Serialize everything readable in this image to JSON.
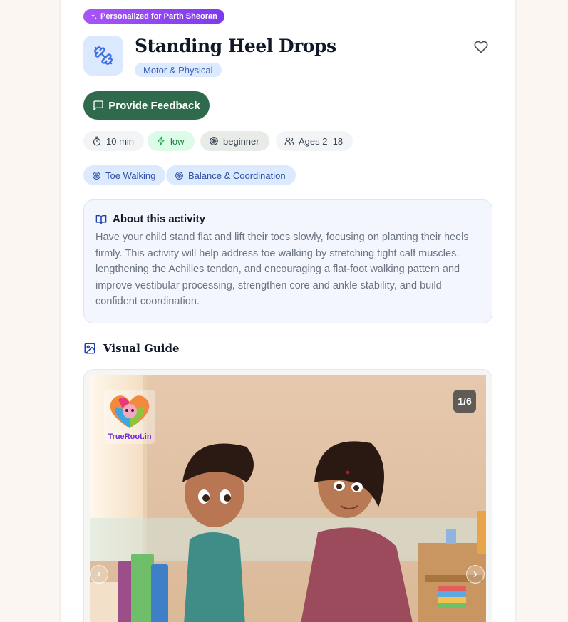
{
  "personalized_badge": "Personalized for Parth Sheoran",
  "activity": {
    "title": "Standing Heel Drops",
    "category": "Motor & Physical"
  },
  "feedback_button": "Provide Feedback",
  "meta_chips": [
    {
      "icon": "timer-icon",
      "label": "10 min"
    },
    {
      "icon": "lightning-icon",
      "label": "low"
    },
    {
      "icon": "target-icon",
      "label": "beginner"
    },
    {
      "icon": "users-icon",
      "label": "Ages 2–18"
    }
  ],
  "tags": [
    {
      "icon": "target-icon",
      "label": "Toe Walking"
    },
    {
      "icon": "target-icon",
      "label": "Balance & Coordination"
    }
  ],
  "about": {
    "heading": "About this activity",
    "text": "Have your child stand flat and lift their toes slowly, focusing on planting their heels firmly. This activity will help address toe walking by stretching tight calf muscles, lengthening the Achilles tendon, and encouraging a flat-foot walking pattern and improve vestibular processing, strengthen core and ankle stability, and build confident coordination."
  },
  "visual_guide": {
    "heading": "Visual Guide",
    "counter": "1/6",
    "watermark": "TrueRoot.in"
  },
  "colors": {
    "primary_green": "#2e6a4b",
    "badge_purple": "#a855f7",
    "tag_blue": "#dbeafe",
    "low_green": "#dcfce7"
  }
}
